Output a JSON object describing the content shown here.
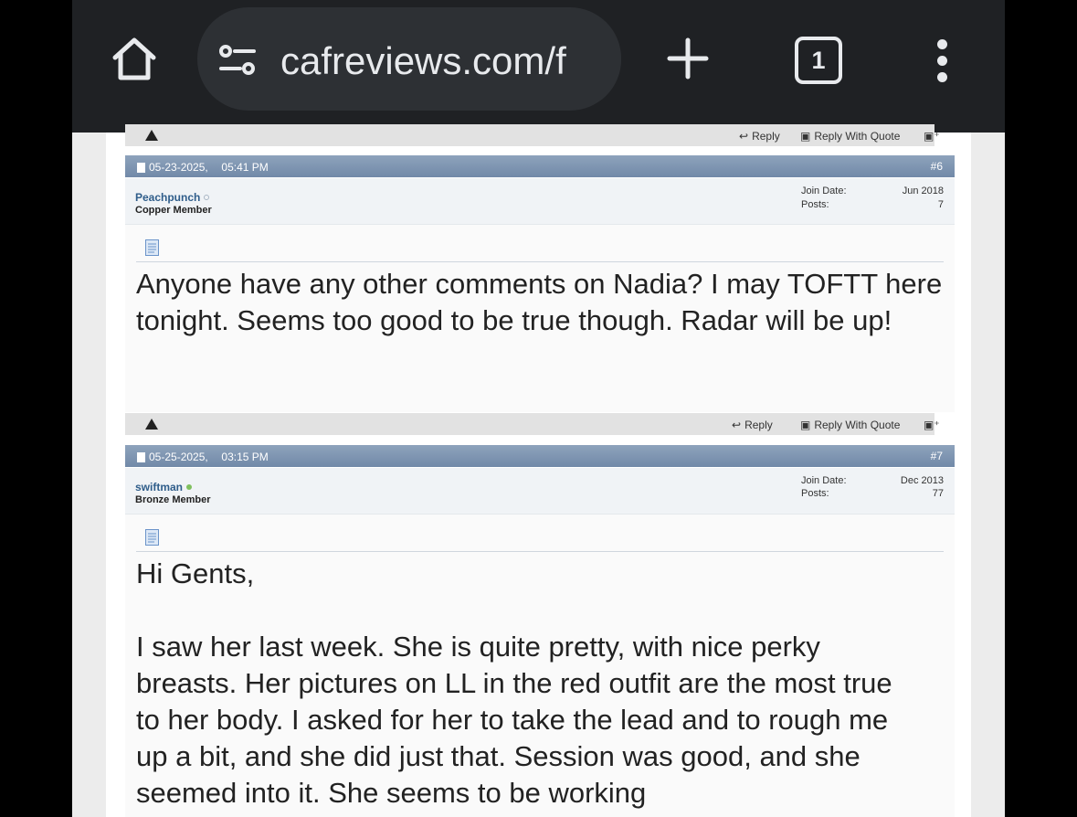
{
  "browser": {
    "url": "cafreviews.com/f",
    "tab_count": "1",
    "icons": {
      "home": "home-icon",
      "site_settings": "tune-icon",
      "new_tab": "plus-icon",
      "tabs": "tab-switcher-icon",
      "menu": "more-vert-icon"
    }
  },
  "actions": {
    "reply": "Reply",
    "reply_quote": "Reply With Quote"
  },
  "posts": [
    {
      "date": "05-23-2025,",
      "time": "05:41 PM",
      "number": "#6",
      "username": "Peachpunch",
      "online": false,
      "user_title": "Copper Member",
      "join_date_label": "Join Date:",
      "join_date": "Jun 2018",
      "posts_label": "Posts:",
      "posts": "7",
      "message": [
        "Anyone have any other comments on Nadia? I may TOFTT here tonight. Seems too good to be true though. Radar will be up!"
      ]
    },
    {
      "date": "05-25-2025,",
      "time": "03:15 PM",
      "number": "#7",
      "username": "swiftman",
      "online": true,
      "user_title": "Bronze Member",
      "join_date_label": "Join Date:",
      "join_date": "Dec 2013",
      "posts_label": "Posts:",
      "posts": "77",
      "message": [
        "Hi Gents,",
        "I saw her last week. She is quite pretty, with nice perky breasts. Her pictures on LL in the red outfit are the most true to her body. I asked for her to take the lead and to rough me up a bit, and she did just that. Session was good, and she seemed into it. She seems to be working"
      ]
    }
  ],
  "colors": {
    "header_bar": "#7f96b3",
    "online": "#7fc05e",
    "offline": "#a9b6c4",
    "link": "#2f5d8a"
  }
}
